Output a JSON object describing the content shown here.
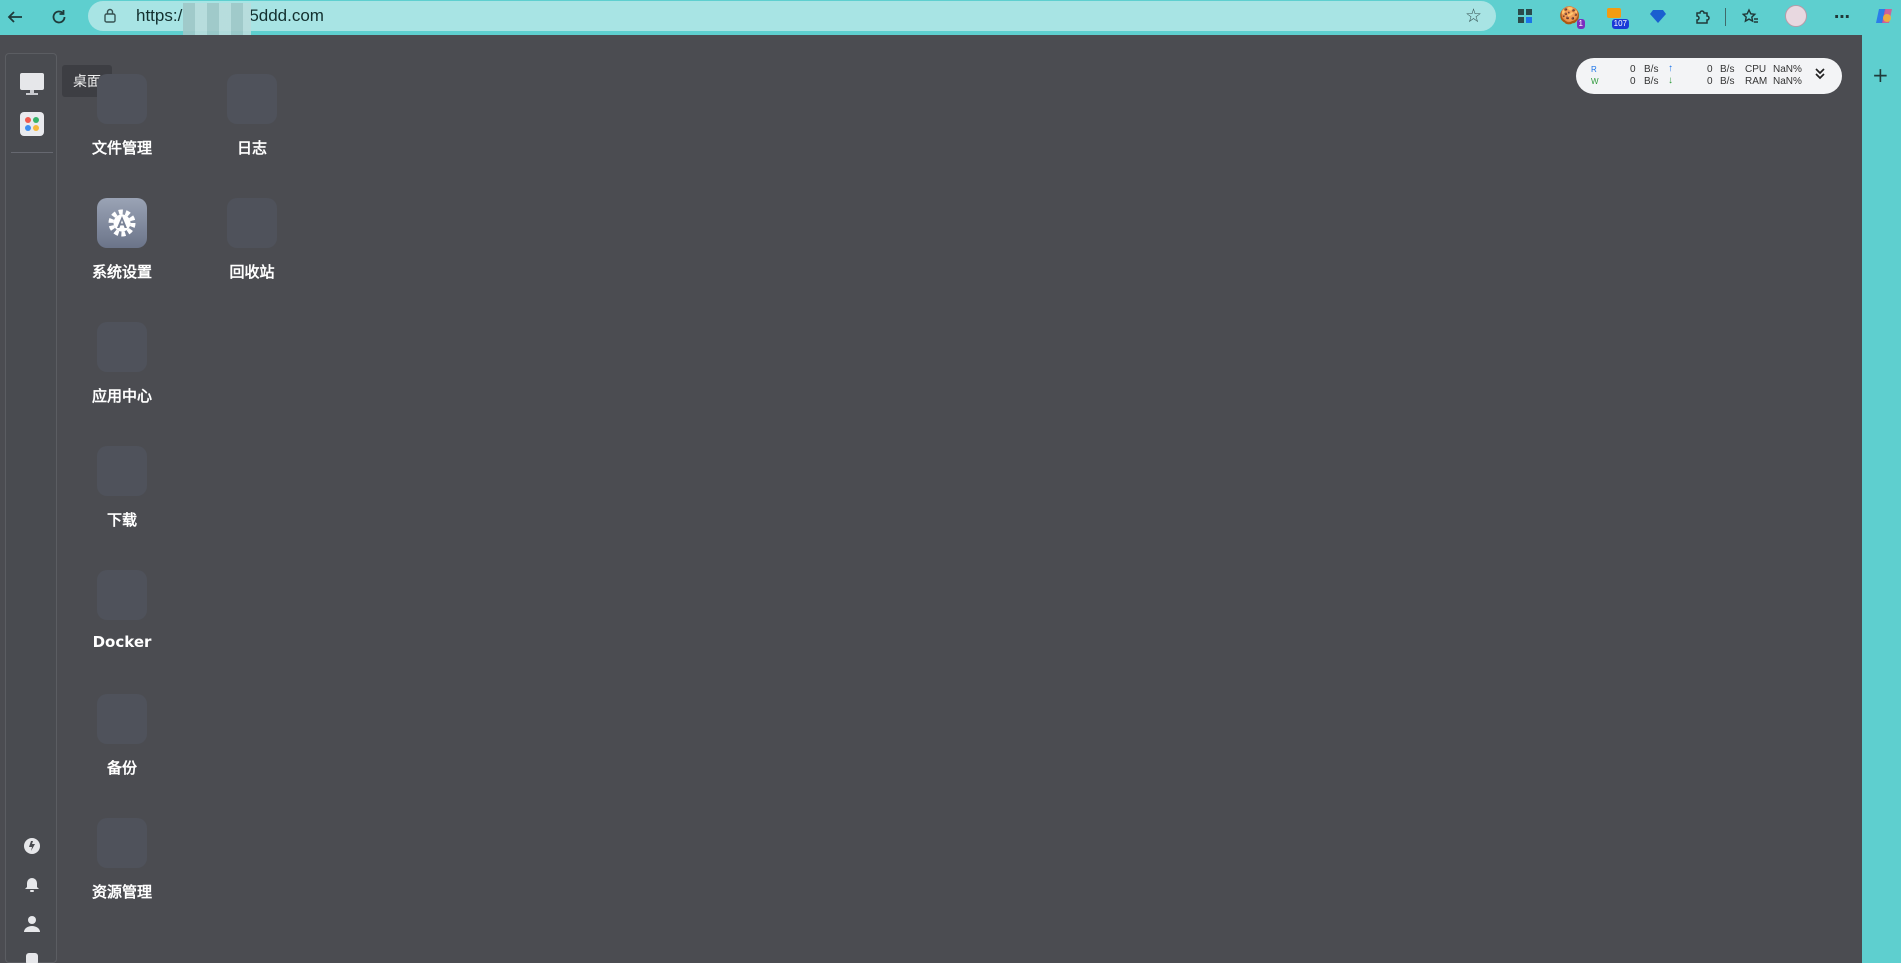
{
  "browser": {
    "url_prefix": "https:/",
    "url_suffix": "5ddd.com",
    "ext_badges": {
      "cookie": "1",
      "rss": "107"
    }
  },
  "dock": {
    "tooltip": "桌面"
  },
  "desktop": {
    "icons": [
      {
        "label": "文件管理"
      },
      {
        "label": "日志"
      },
      {
        "label": "系统设置"
      },
      {
        "label": "回收站"
      },
      {
        "label": "应用中心"
      },
      {
        "label": "下载"
      },
      {
        "label": "Docker"
      },
      {
        "label": "备份"
      },
      {
        "label": "资源管理"
      }
    ]
  },
  "stats": {
    "read_label": "R",
    "write_label": "W",
    "read_value": "0",
    "write_value": "0",
    "unit": "B/s",
    "up_value": "0",
    "down_value": "0",
    "cpu_label": "CPU",
    "ram_label": "RAM",
    "cpu_value": "NaN%",
    "ram_value": "NaN%"
  },
  "colors": {
    "browser_bg": "#5ecfcf",
    "desktop_bg": "#4b4c51",
    "up_arrow": "#1a73e8",
    "down_arrow": "#2e9a3a"
  }
}
